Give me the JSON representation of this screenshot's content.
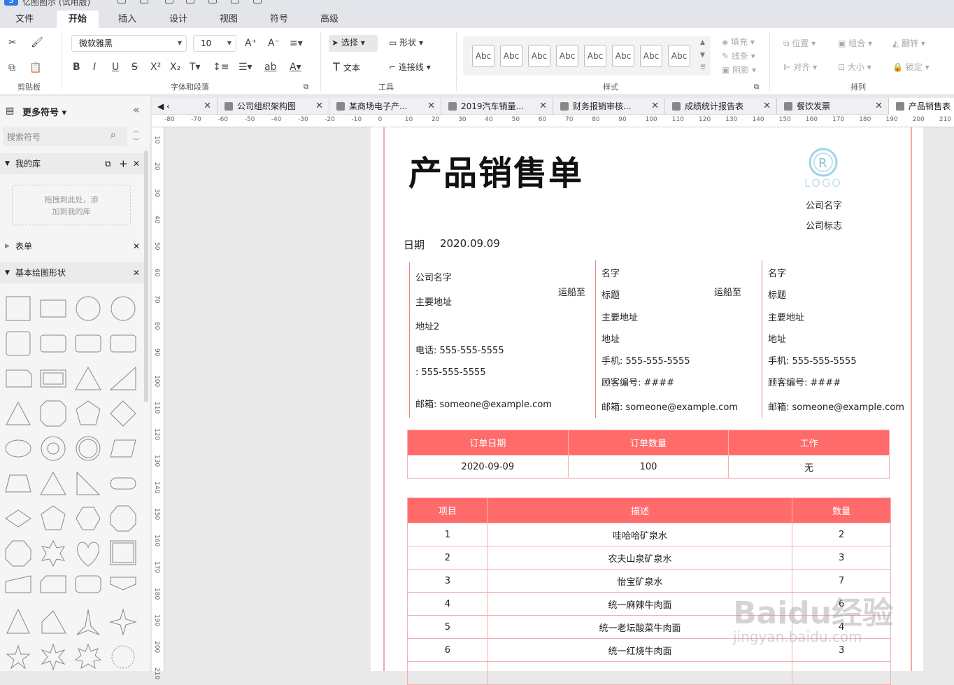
{
  "app": {
    "logo": "S",
    "title": "亿图图示 (试用版)"
  },
  "menu": {
    "tabs": [
      "文件",
      "开始",
      "插入",
      "设计",
      "视图",
      "符号",
      "高级"
    ],
    "active": "开始"
  },
  "ribbon": {
    "font_name": "微软雅黑",
    "font_size": "10",
    "select_label": "选择",
    "shape_label": "形状",
    "text_label": "文本",
    "connector_label": "连接线",
    "abc_labels": [
      "Abc",
      "Abc",
      "Abc",
      "Abc",
      "Abc",
      "Abc",
      "Abc",
      "Abc"
    ],
    "fill_label": "填充",
    "line_label": "线条",
    "shadow_label": "阴影",
    "position_label": "位置",
    "group_label": "组合",
    "flip_label": "翻转",
    "align_label": "对齐",
    "size_label": "大小",
    "lock_label": "锁定",
    "groups": {
      "clipboard": "剪贴板",
      "font": "字体和段落",
      "tools": "工具",
      "style": "样式",
      "arrange": "排列"
    },
    "underline_ab": "ab"
  },
  "left_panel": {
    "title": "更多符号",
    "search_placeholder": "搜索符号",
    "my_lib": "我的库",
    "drop_hint_1": "拖拽到此处，添",
    "drop_hint_2": "加到我的库",
    "form_lib": "表单",
    "basic_shapes": "基本绘图形状"
  },
  "tabs": [
    {
      "label": "‹"
    },
    {
      "label": "公司组织架构图"
    },
    {
      "label": "某商场电子产..."
    },
    {
      "label": "2019汽车销量..."
    },
    {
      "label": "财务报销审核..."
    },
    {
      "label": "成绩统计报告表"
    },
    {
      "label": "餐饮发票"
    },
    {
      "label": "产品销售表"
    }
  ],
  "ruler": {
    "h": [
      "-80",
      "-70",
      "-60",
      "-50",
      "-40",
      "-30",
      "-20",
      "-10",
      "0",
      "10",
      "20",
      "30",
      "40",
      "50",
      "60",
      "70",
      "80",
      "90",
      "100",
      "110",
      "120",
      "130",
      "140",
      "150",
      "160",
      "170",
      "180",
      "190",
      "200",
      "210"
    ],
    "v": [
      "10",
      "20",
      "30",
      "40",
      "50",
      "60",
      "70",
      "80",
      "90",
      "100",
      "110",
      "120",
      "130",
      "140",
      "150",
      "160",
      "170",
      "180",
      "190",
      "200",
      "210"
    ]
  },
  "document": {
    "title": "产品销售单",
    "logo_text": "LOGO",
    "company_name": "公司名字",
    "company_sign": "公司标志",
    "date_label": "日期",
    "date_value": "2020.09.09",
    "sender": {
      "name": "公司名字",
      "addr": "主要地址",
      "addr2": "地址2",
      "phone": "电话: 555-555-5555",
      "fax": ": 555-555-5555",
      "email": "邮箱: someone@example.com"
    },
    "ship_to_1": "运船至",
    "ship_to_2": "运船至",
    "recipient1": {
      "name": "名字",
      "title": "标题",
      "addr": "主要地址",
      "addr2": "地址",
      "mobile": "手机: 555-555-5555",
      "cust": "顾客编号: ####",
      "email": "邮箱: someone@example.com"
    },
    "recipient2": {
      "name": "名字",
      "title": "标题",
      "addr": "主要地址",
      "addr2": "地址",
      "mobile": "手机: 555-555-5555",
      "cust": "顾客编号: ####",
      "email": "邮箱: someone@example.com"
    },
    "order_table": {
      "headers": [
        "订单日期",
        "订单数量",
        "工作"
      ],
      "row": [
        "2020-09-09",
        "100",
        "无"
      ]
    },
    "items_table": {
      "headers": [
        "项目",
        "描述",
        "数量"
      ],
      "rows": [
        [
          "1",
          "哇哈哈矿泉水",
          "2"
        ],
        [
          "2",
          "农夫山泉矿泉水",
          "3"
        ],
        [
          "3",
          "怡宝矿泉水",
          "7"
        ],
        [
          "4",
          "统一麻辣牛肉面",
          "6"
        ],
        [
          "5",
          "统一老坛酸菜牛肉面",
          "4"
        ],
        [
          "6",
          "统一红烧牛肉面",
          "3"
        ]
      ]
    }
  },
  "watermark": {
    "brand": "Baidu经验",
    "url": "jingyan.baidu.com"
  }
}
